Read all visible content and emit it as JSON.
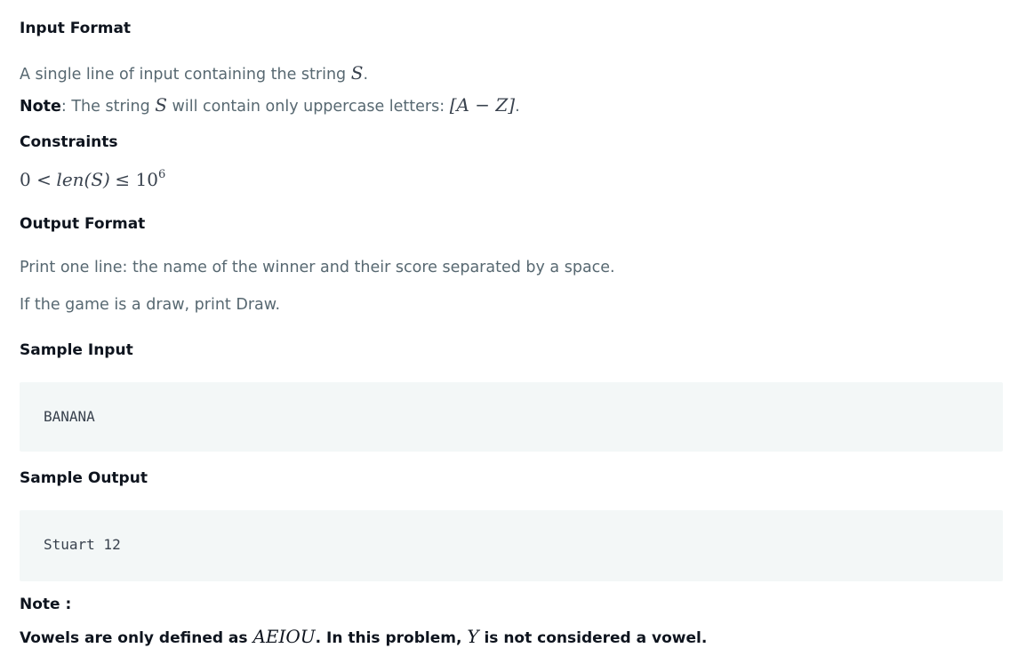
{
  "input_format": {
    "heading": "Input Format",
    "line1_prefix": "A single line of input containing the string ",
    "line1_var": "S",
    "line1_suffix": ".",
    "note_label": "Note",
    "note_prefix": ": The string ",
    "note_var": "S",
    "note_middle": " will contain only uppercase letters: ",
    "note_range": "[A − Z]",
    "note_suffix": "."
  },
  "constraints": {
    "heading": "Constraints",
    "expr_left": "0 <",
    "expr_func": "len(S)",
    "expr_op": "≤ 10",
    "expr_exp": "6"
  },
  "output_format": {
    "heading": "Output Format",
    "line1": "Print one line: the name of the winner and their score separated by a space.",
    "line2": "If the game is a draw, print Draw."
  },
  "sample_input": {
    "heading": "Sample Input",
    "code": "BANANA"
  },
  "sample_output": {
    "heading": "Sample Output",
    "code": "Stuart 12"
  },
  "note": {
    "heading": "Note :",
    "prefix": "Vowels are only defined as ",
    "vowels": "AEIOU",
    "middle": ". In this problem, ",
    "y_var": "Y",
    "suffix": " is not considered a vowel."
  }
}
